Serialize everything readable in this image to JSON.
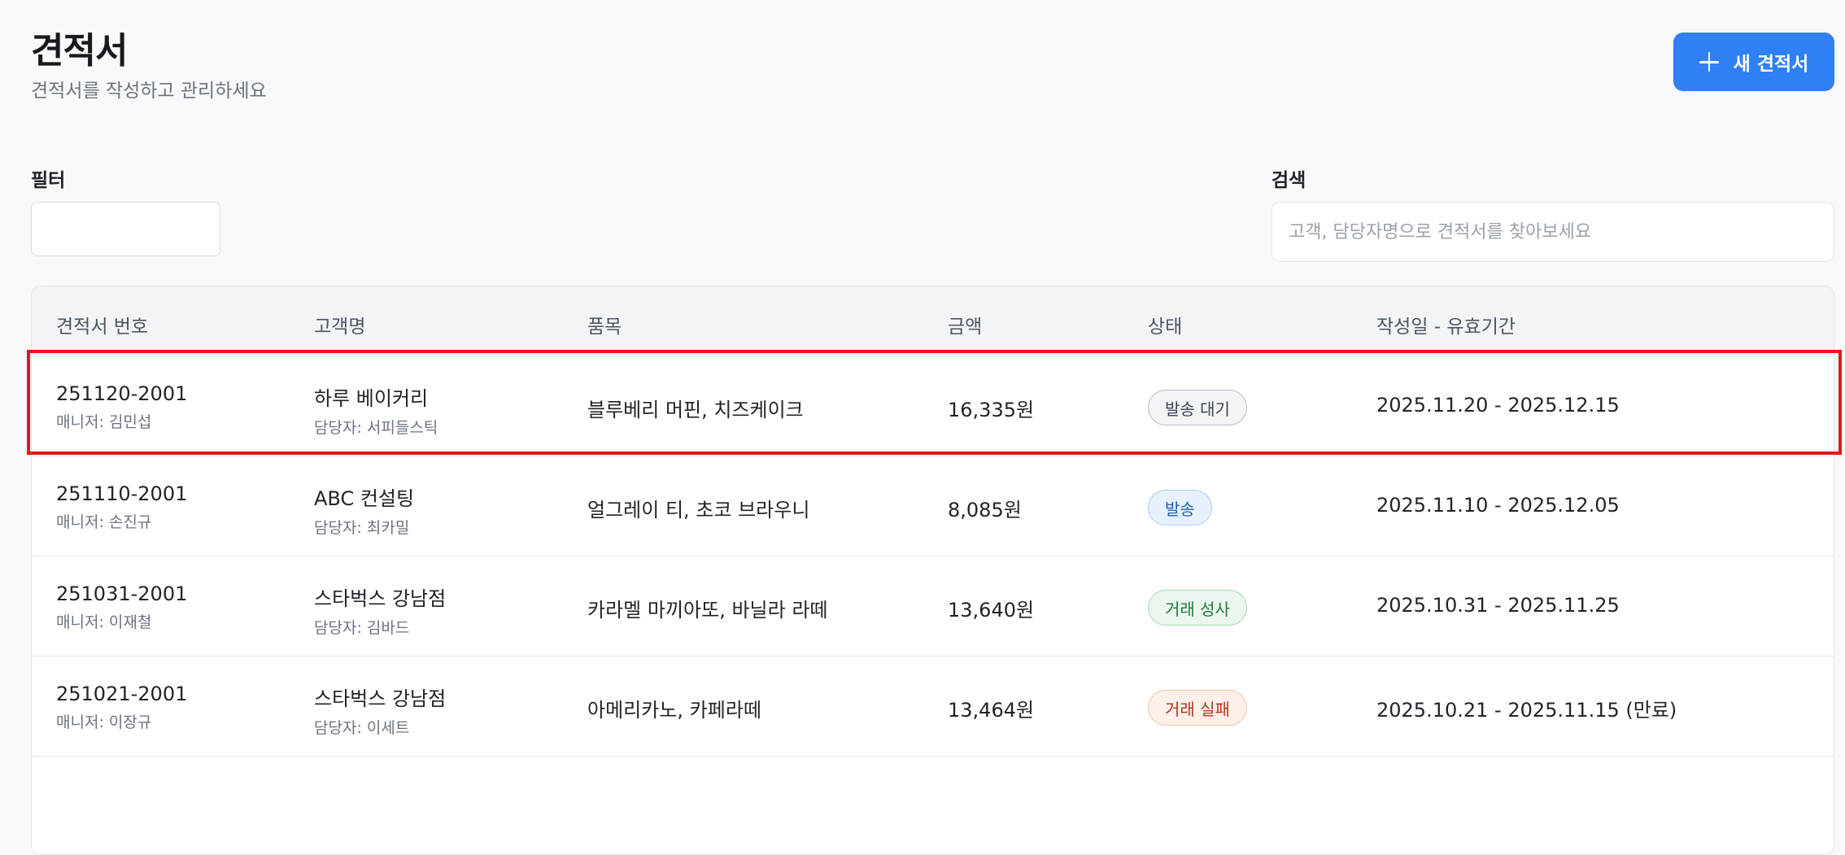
{
  "header": {
    "title": "견적서",
    "subtitle": "견적서를 작성하고 관리하세요",
    "new_button_label": "새 견적서"
  },
  "filters": {
    "filter_label": "필터",
    "search_label": "검색",
    "search_placeholder": "고객, 담당자명으로 견적서를 찾아보세요",
    "search_value": ""
  },
  "table": {
    "columns": [
      "견적서 번호",
      "고객명",
      "품목",
      "금액",
      "상태",
      "작성일 - 유효기간"
    ],
    "rows": [
      {
        "quote_number": "251120-2001",
        "manager": "매니저: 김민섭",
        "customer": "하루 베이커리",
        "contact": "담당자: 서피들스틱",
        "items": "블루베리 머핀, 치즈케이크",
        "amount": "16,335원",
        "status": "발송 대기",
        "period": "2025.11.20 - 2025.12.15"
      },
      {
        "quote_number": "251110-2001",
        "manager": "매니저: 손진규",
        "customer": "ABC 컨설팅",
        "contact": "담당자: 최카밀",
        "items": "얼그레이 티, 초코 브라우니",
        "amount": "8,085원",
        "status": "발송",
        "period": "2025.11.10 - 2025.12.05"
      },
      {
        "quote_number": "251031-2001",
        "manager": "매니저: 이재철",
        "customer": "스타벅스 강남점",
        "contact": "담당자: 김바드",
        "items": "카라멜 마끼아또, 바닐라 라떼",
        "amount": "13,640원",
        "status": "거래 성사",
        "period": "2025.10.31 - 2025.11.25"
      },
      {
        "quote_number": "251021-2001",
        "manager": "매니저: 이장규",
        "customer": "스타벅스 강남점",
        "contact": "담당자: 이세트",
        "items": "아메리카노, 카페라떼",
        "amount": "13,464원",
        "status": "거래 실패",
        "period": "2025.10.21 - 2025.11.15 (만료)"
      }
    ]
  },
  "colors": {
    "accent": "#2f80f5",
    "highlight": "#e61717",
    "status_pending": "#374151",
    "status_sent": "#1d5fb8",
    "status_won": "#1e7a3d",
    "status_lost": "#b4331f"
  },
  "icons": {
    "new_button_icon": "plus-icon"
  }
}
